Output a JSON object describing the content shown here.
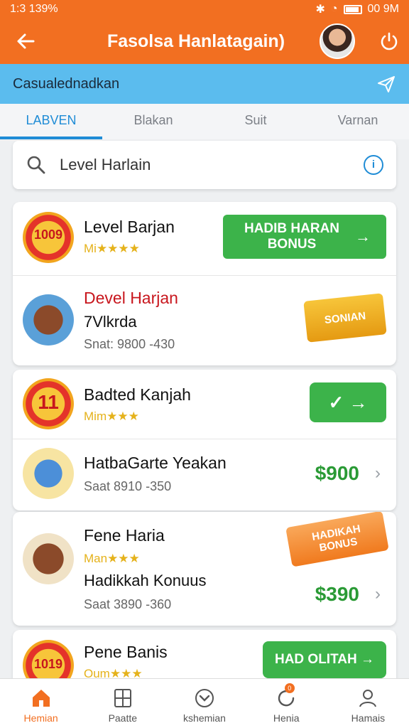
{
  "status_bar": {
    "time": "1:3 139% ",
    "right_text": "00 9M"
  },
  "header": {
    "title": "Fasolsa Hanlatagain)"
  },
  "banner": {
    "text": "Casualednadkan"
  },
  "tabs": [
    {
      "label": "LABVEN",
      "active": true
    },
    {
      "label": "Blakan"
    },
    {
      "label": "Suit"
    },
    {
      "label": "Varnan"
    }
  ],
  "search": {
    "value": "Level Harlain",
    "info_glyph": "i"
  },
  "cards": [
    {
      "rows": [
        {
          "title": "Level Barjan",
          "stars": "Mi★★★★",
          "button": "HADIB HARAN BONUS",
          "badge": "1009"
        },
        {
          "title": "Devel Harjan",
          "line2": "7Vlkrda",
          "meta": "Snat: 9800 -430",
          "ribbon": "SONIAN"
        }
      ]
    },
    {
      "rows": [
        {
          "title": "Badted Kanjah",
          "stars": "Mim★★★",
          "badge": "11",
          "button_symbol": "✓ →"
        },
        {
          "title": "HatbaGarte Yeakan",
          "meta": "Saat 8910 -350",
          "price": "$900"
        }
      ]
    },
    {
      "rows": [
        {
          "title": "Fene Haria",
          "stars": "Man★★★",
          "line2": "Hadikkah Konuus",
          "meta": "Saat 3890 -360",
          "price": "$390",
          "ribbon": "HADIKAH BONUS"
        }
      ]
    },
    {
      "rows": [
        {
          "title": "Pene Banis",
          "stars": "Oum★★★",
          "badge": "1019",
          "button": "HAD OLITAH →"
        }
      ]
    }
  ],
  "chevron": "›",
  "nav": [
    {
      "label": "Hemian",
      "icon": "home-icon",
      "active": true
    },
    {
      "label": "Paatte",
      "icon": "cards-icon"
    },
    {
      "label": "kshemian",
      "icon": "chevron-circle-icon"
    },
    {
      "label": "Henia",
      "icon": "refresh-icon",
      "badge": "0"
    },
    {
      "label": "Hamais",
      "icon": "profile-icon"
    }
  ]
}
